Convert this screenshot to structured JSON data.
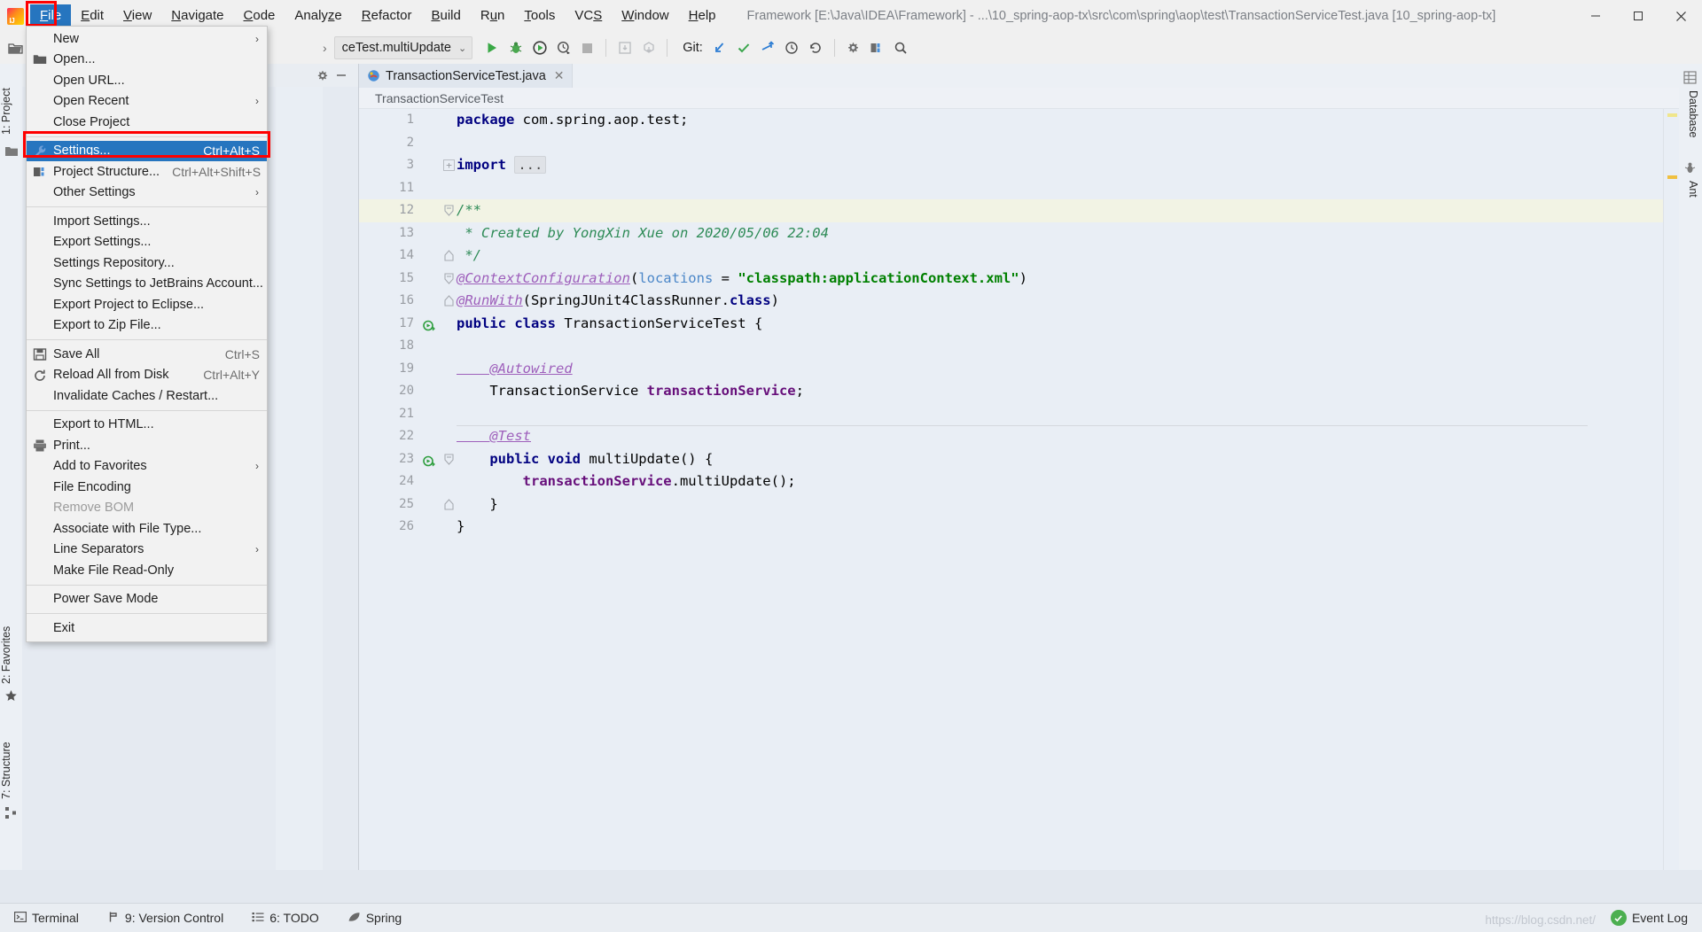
{
  "window": {
    "title": "Framework [E:\\Java\\IDEA\\Framework] - ...\\10_spring-aop-tx\\src\\com\\spring\\aop\\test\\TransactionServiceTest.java [10_spring-aop-tx]",
    "minimize": "–",
    "maximize": "❐",
    "close": "✕"
  },
  "menubar": {
    "items": [
      {
        "label": "File",
        "mnemonic": "F",
        "active": true
      },
      {
        "label": "Edit",
        "mnemonic": "E",
        "active": false
      },
      {
        "label": "View",
        "mnemonic": "V",
        "active": false
      },
      {
        "label": "Navigate",
        "mnemonic": "N",
        "active": false
      },
      {
        "label": "Code",
        "mnemonic": "C",
        "active": false
      },
      {
        "label": "Analyze",
        "mnemonic": "z",
        "active": false
      },
      {
        "label": "Refactor",
        "mnemonic": "R",
        "active": false
      },
      {
        "label": "Build",
        "mnemonic": "B",
        "active": false
      },
      {
        "label": "Run",
        "mnemonic": "u",
        "active": false
      },
      {
        "label": "Tools",
        "mnemonic": "T",
        "active": false
      },
      {
        "label": "VCS",
        "mnemonic": "S",
        "active": false
      },
      {
        "label": "Window",
        "mnemonic": "W",
        "active": false
      },
      {
        "label": "Help",
        "mnemonic": "H",
        "active": false
      }
    ]
  },
  "file_menu": {
    "items": [
      {
        "label": "New",
        "shortcut": "",
        "icon": "",
        "submenu": true,
        "selected": false,
        "disabled": false
      },
      {
        "label": "Open...",
        "shortcut": "",
        "icon": "folder-icon",
        "submenu": false,
        "selected": false,
        "disabled": false
      },
      {
        "label": "Open URL...",
        "shortcut": "",
        "icon": "",
        "submenu": false,
        "selected": false,
        "disabled": false
      },
      {
        "label": "Open Recent",
        "shortcut": "",
        "icon": "",
        "submenu": true,
        "selected": false,
        "disabled": false
      },
      {
        "label": "Close Project",
        "shortcut": "",
        "icon": "",
        "submenu": false,
        "selected": false,
        "disabled": false
      },
      {
        "separator": true
      },
      {
        "label": "Settings...",
        "shortcut": "Ctrl+Alt+S",
        "icon": "wrench-icon",
        "submenu": false,
        "selected": true,
        "disabled": false
      },
      {
        "label": "Project Structure...",
        "shortcut": "Ctrl+Alt+Shift+S",
        "icon": "module-icon",
        "submenu": false,
        "selected": false,
        "disabled": false
      },
      {
        "label": "Other Settings",
        "shortcut": "",
        "icon": "",
        "submenu": true,
        "selected": false,
        "disabled": false
      },
      {
        "separator": true
      },
      {
        "label": "Import Settings...",
        "shortcut": "",
        "icon": "",
        "submenu": false,
        "selected": false,
        "disabled": false
      },
      {
        "label": "Export Settings...",
        "shortcut": "",
        "icon": "",
        "submenu": false,
        "selected": false,
        "disabled": false
      },
      {
        "label": "Settings Repository...",
        "shortcut": "",
        "icon": "",
        "submenu": false,
        "selected": false,
        "disabled": false
      },
      {
        "label": "Sync Settings to JetBrains Account...",
        "shortcut": "",
        "icon": "",
        "submenu": false,
        "selected": false,
        "disabled": false
      },
      {
        "label": "Export Project to Eclipse...",
        "shortcut": "",
        "icon": "",
        "submenu": false,
        "selected": false,
        "disabled": false
      },
      {
        "label": "Export to Zip File...",
        "shortcut": "",
        "icon": "",
        "submenu": false,
        "selected": false,
        "disabled": false
      },
      {
        "separator": true
      },
      {
        "label": "Save All",
        "shortcut": "Ctrl+S",
        "icon": "save-icon",
        "submenu": false,
        "selected": false,
        "disabled": false
      },
      {
        "label": "Reload All from Disk",
        "shortcut": "Ctrl+Alt+Y",
        "icon": "reload-icon",
        "submenu": false,
        "selected": false,
        "disabled": false
      },
      {
        "label": "Invalidate Caches / Restart...",
        "shortcut": "",
        "icon": "",
        "submenu": false,
        "selected": false,
        "disabled": false
      },
      {
        "separator": true
      },
      {
        "label": "Export to HTML...",
        "shortcut": "",
        "icon": "",
        "submenu": false,
        "selected": false,
        "disabled": false
      },
      {
        "label": "Print...",
        "shortcut": "",
        "icon": "printer-icon",
        "submenu": false,
        "selected": false,
        "disabled": false
      },
      {
        "label": "Add to Favorites",
        "shortcut": "",
        "icon": "",
        "submenu": true,
        "selected": false,
        "disabled": false
      },
      {
        "label": "File Encoding",
        "shortcut": "",
        "icon": "",
        "submenu": false,
        "selected": false,
        "disabled": false
      },
      {
        "label": "Remove BOM",
        "shortcut": "",
        "icon": "",
        "submenu": false,
        "selected": false,
        "disabled": true
      },
      {
        "label": "Associate with File Type...",
        "shortcut": "",
        "icon": "",
        "submenu": false,
        "selected": false,
        "disabled": false
      },
      {
        "label": "Line Separators",
        "shortcut": "",
        "icon": "",
        "submenu": true,
        "selected": false,
        "disabled": false
      },
      {
        "label": "Make File Read-Only",
        "shortcut": "",
        "icon": "",
        "submenu": false,
        "selected": false,
        "disabled": false
      },
      {
        "separator": true
      },
      {
        "label": "Power Save Mode",
        "shortcut": "",
        "icon": "",
        "submenu": false,
        "selected": false,
        "disabled": false
      },
      {
        "separator": true
      },
      {
        "label": "Exit",
        "shortcut": "",
        "icon": "",
        "submenu": false,
        "selected": false,
        "disabled": false
      }
    ]
  },
  "toolbar": {
    "run_config": "ceTest.multiUpdate",
    "run_config_chevron": "⌄",
    "git_label": "Git:",
    "buttons": [
      {
        "name": "run-button",
        "title": "Run"
      },
      {
        "name": "debug-button",
        "title": "Debug"
      },
      {
        "name": "run-coverage-button",
        "title": "Run with Coverage"
      },
      {
        "name": "profile-button",
        "title": "Profile"
      },
      {
        "name": "stop-button",
        "title": "Stop"
      },
      {
        "name": "update-project-button",
        "title": "Update Project"
      },
      {
        "name": "commit-button",
        "title": "Commit"
      }
    ],
    "git_buttons": [
      {
        "name": "git-update-icon",
        "title": "Update Project"
      },
      {
        "name": "git-commit-icon",
        "title": "Commit"
      },
      {
        "name": "git-push-icon",
        "title": "Push"
      },
      {
        "name": "git-history-icon",
        "title": "History"
      },
      {
        "name": "git-revert-icon",
        "title": "Revert"
      }
    ],
    "right_buttons": [
      {
        "name": "settings-gear-icon",
        "title": "Settings"
      },
      {
        "name": "project-structure-icon",
        "title": "Project Structure"
      },
      {
        "name": "search-everywhere-icon",
        "title": "Search Everywhere"
      },
      {
        "name": "find-icon",
        "title": "Find"
      }
    ]
  },
  "left_tool_window": {
    "project_tab": "1: Project",
    "favorites_tab": "2: Favorites",
    "structure_tab": "7: Structure"
  },
  "right_tool_window": {
    "database_tab": "Database",
    "ant_tab": "Ant"
  },
  "editor": {
    "tab_label": "TransactionServiceTest.java",
    "tab_close": "✕",
    "breadcrumb": "TransactionServiceTest"
  },
  "code": {
    "lines": [
      {
        "num": "1",
        "highlight": false,
        "marker": "",
        "fold": "",
        "tokens": [
          {
            "t": "package ",
            "c": "k"
          },
          {
            "t": "com.spring.aop.test;",
            "c": "plain"
          }
        ]
      },
      {
        "num": "2",
        "highlight": false,
        "marker": "",
        "fold": "",
        "tokens": []
      },
      {
        "num": "3",
        "highlight": false,
        "marker": "",
        "fold": "plus",
        "tokens": [
          {
            "t": "import ",
            "c": "k"
          },
          {
            "t": "...",
            "c": "dots"
          }
        ]
      },
      {
        "num": "11",
        "highlight": false,
        "marker": "",
        "fold": "",
        "tokens": []
      },
      {
        "num": "12",
        "highlight": true,
        "marker": "",
        "fold": "minus-round",
        "tokens": [
          {
            "t": "/**",
            "c": "cm"
          }
        ]
      },
      {
        "num": "13",
        "highlight": false,
        "marker": "",
        "fold": "",
        "tokens": [
          {
            "t": " * Created by YongXin Xue on 2020/05/06 22:04",
            "c": "cm"
          }
        ]
      },
      {
        "num": "14",
        "highlight": false,
        "marker": "",
        "fold": "end",
        "tokens": [
          {
            "t": " */",
            "c": "cm"
          }
        ]
      },
      {
        "num": "15",
        "highlight": false,
        "marker": "",
        "fold": "minus-round",
        "tokens": [
          {
            "t": "@ContextConfiguration",
            "c": "an"
          },
          {
            "t": "(",
            "c": "plain"
          },
          {
            "t": "locations",
            "c": "pm"
          },
          {
            "t": " = ",
            "c": "plain"
          },
          {
            "t": "\"classpath:applicationContext.xml\"",
            "c": "s"
          },
          {
            "t": ")",
            "c": "plain"
          }
        ]
      },
      {
        "num": "16",
        "highlight": false,
        "marker": "",
        "fold": "end",
        "tokens": [
          {
            "t": "@RunWith",
            "c": "an"
          },
          {
            "t": "(SpringJUnit4ClassRunner.",
            "c": "plain"
          },
          {
            "t": "class",
            "c": "k"
          },
          {
            "t": ")",
            "c": "plain"
          }
        ]
      },
      {
        "num": "17",
        "highlight": false,
        "marker": "run-test",
        "fold": "",
        "tokens": [
          {
            "t": "public class ",
            "c": "k"
          },
          {
            "t": "TransactionServiceTest {",
            "c": "plain"
          }
        ]
      },
      {
        "num": "18",
        "highlight": false,
        "marker": "",
        "fold": "",
        "tokens": []
      },
      {
        "num": "19",
        "highlight": false,
        "marker": "",
        "fold": "",
        "tokens": [
          {
            "t": "    @Autowired",
            "c": "an"
          }
        ]
      },
      {
        "num": "20",
        "highlight": false,
        "marker": "",
        "fold": "",
        "tokens": [
          {
            "t": "    TransactionService ",
            "c": "plain"
          },
          {
            "t": "transactionService",
            "c": "fd"
          },
          {
            "t": ";",
            "c": "plain"
          }
        ]
      },
      {
        "num": "21",
        "highlight": false,
        "marker": "",
        "fold": "",
        "tokens": []
      },
      {
        "num": "22",
        "highlight": false,
        "marker": "",
        "fold": "",
        "separator_above": true,
        "tokens": [
          {
            "t": "    @Test",
            "c": "an"
          }
        ]
      },
      {
        "num": "23",
        "highlight": false,
        "marker": "run-test",
        "fold": "minus-round",
        "tokens": [
          {
            "t": "    public void ",
            "c": "k"
          },
          {
            "t": "multiUpdate() {",
            "c": "plain"
          }
        ]
      },
      {
        "num": "24",
        "highlight": false,
        "marker": "",
        "fold": "",
        "tokens": [
          {
            "t": "        ",
            "c": "plain"
          },
          {
            "t": "transactionService",
            "c": "fd"
          },
          {
            "t": ".multiUpdate();",
            "c": "plain"
          }
        ]
      },
      {
        "num": "25",
        "highlight": false,
        "marker": "",
        "fold": "end",
        "tokens": [
          {
            "t": "    }",
            "c": "plain"
          }
        ]
      },
      {
        "num": "26",
        "highlight": false,
        "marker": "",
        "fold": "",
        "tokens": [
          {
            "t": "}",
            "c": "plain"
          }
        ]
      }
    ]
  },
  "statusbar": {
    "items": [
      {
        "label": "Terminal",
        "icon": "terminal-icon",
        "mnemonic": ""
      },
      {
        "label": "9: Version Control",
        "icon": "branch-icon",
        "mnemonic": "9"
      },
      {
        "label": "6: TODO",
        "icon": "list-icon",
        "mnemonic": "6"
      },
      {
        "label": "Spring",
        "icon": "leaf-icon",
        "mnemonic": ""
      }
    ],
    "event_log": "Event Log",
    "watermark": "https://blog.csdn.net/"
  },
  "colors": {
    "accent_selection": "#2675bf",
    "annotation_red": "#ff0000",
    "editor_bg": "#e9eef5",
    "highlight_line": "#f2f3e4",
    "keyword": "#000080",
    "string": "#008000",
    "comment": "#2e8b57",
    "annotation": "#9e5fbb",
    "field": "#660e7a",
    "param": "#4a86c8"
  }
}
